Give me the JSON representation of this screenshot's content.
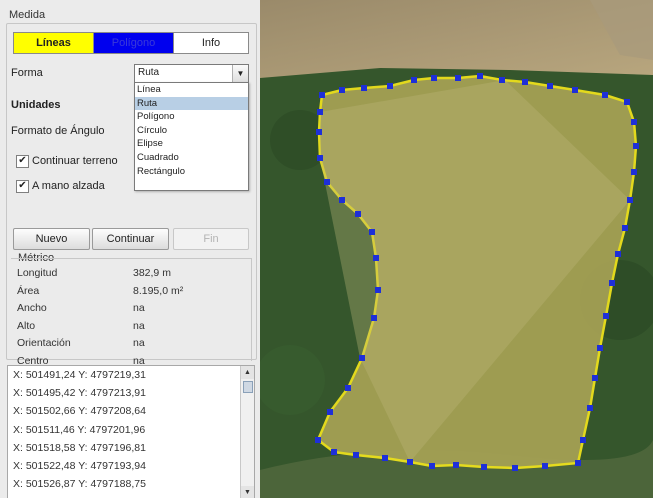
{
  "measure_panel": {
    "group_title": "Medida",
    "tabs": [
      {
        "label": "Líneas",
        "bg": "#ffff00",
        "color": "#222222"
      },
      {
        "label": "Polígono",
        "bg": "#0000ee",
        "color": "#3a3ad8"
      },
      {
        "label": "Info",
        "bg": "#ffffff",
        "color": "#222222"
      }
    ],
    "forma_label": "Forma",
    "forma_value": "Ruta",
    "forma_options": [
      "Línea",
      "Ruta",
      "Polígono",
      "Círculo",
      "Elipse",
      "Cuadrado",
      "Rectángulo"
    ],
    "forma_selected_index": 1,
    "unidades_label": "Unidades",
    "angulo_label": "Formato de Ángulo",
    "continuar_terreno": {
      "label": "Continuar terreno",
      "checked": true
    },
    "mano_alzada": {
      "label": "A mano alzada",
      "checked": true
    },
    "buttons": {
      "nuevo": "Nuevo",
      "continuar": "Continuar",
      "fin": "Fin"
    }
  },
  "metrico": {
    "title": "Métrico",
    "rows": [
      {
        "key": "Longitud",
        "value": "382,9 m"
      },
      {
        "key": "Área",
        "value": "8.195,0 m²"
      },
      {
        "key": "Ancho",
        "value": "na"
      },
      {
        "key": "Alto",
        "value": "na"
      },
      {
        "key": "Orientación",
        "value": "na"
      },
      {
        "key": "Centro",
        "value": "na"
      }
    ]
  },
  "coordinates": [
    "X: 501491,24  Y: 4797219,31",
    "X: 501495,42  Y: 4797213,91",
    "X: 501502,66  Y: 4797208,64",
    "X: 501511,46  Y: 4797201,96",
    "X: 501518,58  Y: 4797196,81",
    "X: 501522,48  Y: 4797193,94",
    "X: 501526,87  Y: 4797188,75"
  ],
  "map": {
    "field_color": "#a7a255",
    "outline_color": "#f2e51c",
    "vertex_color": "#1e2fd8",
    "forest_color": "#35562c"
  }
}
